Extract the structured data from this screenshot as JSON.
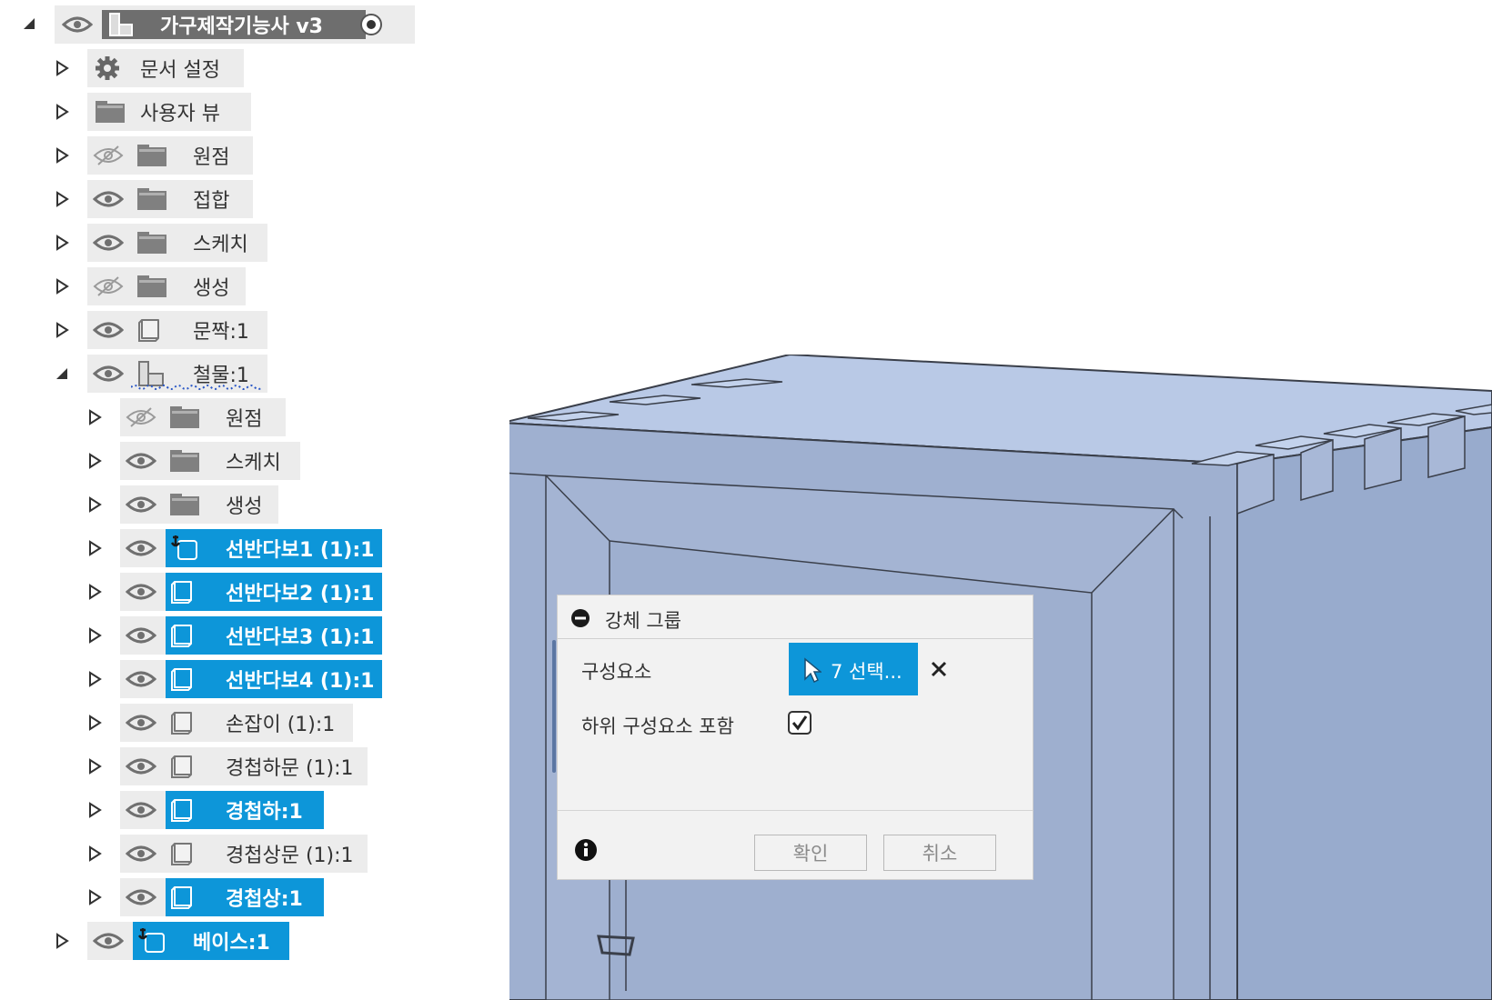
{
  "root": {
    "title": "가구제작기능사 v3"
  },
  "tree": [
    {
      "label": "문서 설정",
      "icon": "gear-icon",
      "visibility": "none",
      "selected": false
    },
    {
      "label": "사용자 뷰",
      "icon": "folder-icon",
      "visibility": "none",
      "selected": false
    },
    {
      "label": "원점",
      "icon": "folder-icon",
      "visibility": "hidden",
      "selected": false
    },
    {
      "label": "접합",
      "icon": "folder-icon",
      "visibility": "visible",
      "selected": false
    },
    {
      "label": "스케치",
      "icon": "folder-icon",
      "visibility": "visible",
      "selected": false
    },
    {
      "label": "생성",
      "icon": "folder-icon",
      "visibility": "hidden",
      "selected": false
    },
    {
      "label": "문짝:1",
      "icon": "body-icon",
      "visibility": "visible",
      "selected": false
    },
    {
      "label": "철물:1",
      "icon": "component-icon",
      "visibility": "visible",
      "selected": false,
      "expanded": true
    },
    {
      "label": "원점",
      "icon": "folder-icon",
      "visibility": "hidden",
      "selected": false
    },
    {
      "label": "스케치",
      "icon": "folder-icon",
      "visibility": "visible",
      "selected": false
    },
    {
      "label": "생성",
      "icon": "folder-icon",
      "visibility": "visible",
      "selected": false
    },
    {
      "label": "선반다보1 (1):1",
      "icon": "anchored-body-icon",
      "visibility": "visible",
      "selected": true
    },
    {
      "label": "선반다보2 (1):1",
      "icon": "body-icon",
      "visibility": "visible",
      "selected": true
    },
    {
      "label": "선반다보3 (1):1",
      "icon": "body-icon",
      "visibility": "visible",
      "selected": true
    },
    {
      "label": "선반다보4 (1):1",
      "icon": "body-icon",
      "visibility": "visible",
      "selected": true
    },
    {
      "label": "손잡이 (1):1",
      "icon": "body-icon",
      "visibility": "visible",
      "selected": false
    },
    {
      "label": "경첩하문 (1):1",
      "icon": "body-icon",
      "visibility": "visible",
      "selected": false
    },
    {
      "label": "경첩하:1",
      "icon": "body-icon",
      "visibility": "visible",
      "selected": true
    },
    {
      "label": "경첩상문 (1):1",
      "icon": "body-icon",
      "visibility": "visible",
      "selected": false
    },
    {
      "label": "경첩상:1",
      "icon": "body-icon",
      "visibility": "visible",
      "selected": true
    },
    {
      "label": "베이스:1",
      "icon": "anchored-body-icon",
      "visibility": "visible",
      "selected": true
    }
  ],
  "dialog": {
    "title": "강체 그룹",
    "components_label": "구성요소",
    "select_button": "7 선택...",
    "include_sub_label": "하위 구성요소 포함",
    "include_sub_checked": true,
    "ok_button": "확인",
    "cancel_button": "취소"
  },
  "colors": {
    "selection": "#0d96d9",
    "model_side": "#9daecf",
    "model_top": "#b7c8e6"
  }
}
